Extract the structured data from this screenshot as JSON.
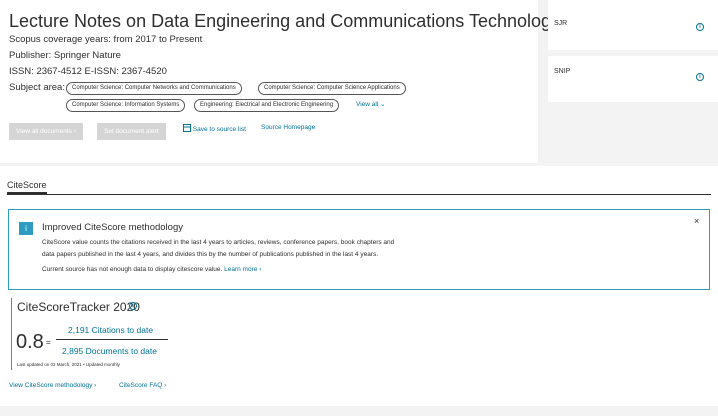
{
  "source": {
    "title": "Lecture Notes on Data Engineering and Communications Technologies",
    "coverage": "Scopus coverage years:   from 2017 to Present",
    "publisher": "Publisher:   Springer Nature",
    "issn": "ISSN:   2367-4512   E-ISSN:   2367-4520",
    "subject_label": "Subject area:",
    "subjects": [
      "Computer Science: Computer Networks and Communications",
      "Computer Science: Computer Science Applications",
      "Computer Science: Information Systems",
      "Engineering: Electrical and Electronic Engineering"
    ],
    "view_all": "View all",
    "view_all_documents": "View all documents",
    "set_alert": "Set document alert",
    "save_to_list": "Save to source list",
    "source_homepage": "Source Homepage"
  },
  "metrics": {
    "sjr_label": "SJR",
    "snip_label": "SNIP"
  },
  "citescore": {
    "tab_label": "CiteScore",
    "notice_title": "Improved CiteScore methodology",
    "notice_line1": "CiteScore value counts the citations received in the last 4 years to articles, reviews, conference papers, book chapters and",
    "notice_line2": "data papers published in the last 4 years, and divides this by the number of publications published in the last 4 years.",
    "notice_line3": "Current source has not enough data to display citescore value.",
    "learn_more": "Learn more",
    "tracker_title": "CiteScoreTracker 2020",
    "value": "0.8",
    "equals": "=",
    "citations": "2,191 Citations to date",
    "documents": "2,895 Documents to date",
    "updated": "Last updated on 02 March, 2021 • Updated monthly",
    "methodology_link": "View CiteScore methodology",
    "faq_link": "CiteScore FAQ"
  },
  "colors": {
    "accent": "#007398",
    "notice_border": "#2e9bc0"
  }
}
